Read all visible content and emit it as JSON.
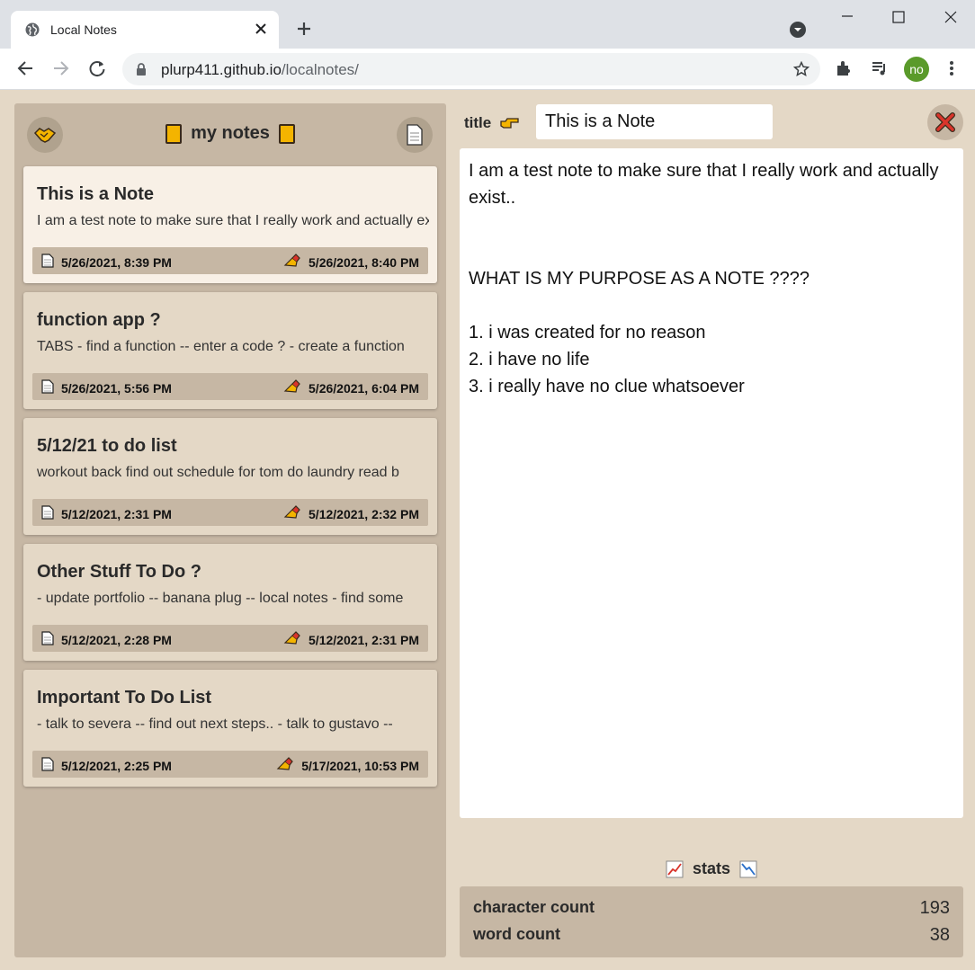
{
  "browser": {
    "tab_title": "Local Notes",
    "url_host": "plurp411.github.io",
    "url_path": "/localnotes/",
    "profile_initials": "no"
  },
  "sidebar": {
    "heading": "my notes",
    "notes": [
      {
        "title": "This is a Note",
        "preview": "I am a test note to make sure that I really work and actually exist..",
        "created": "5/26/2021, 8:39 PM",
        "edited": "5/26/2021, 8:40 PM"
      },
      {
        "title": "function app ?",
        "preview": "TABS - find a function -- enter a code ? - create a function",
        "created": "5/26/2021, 5:56 PM",
        "edited": "5/26/2021, 6:04 PM"
      },
      {
        "title": "5/12/21 to do list",
        "preview": "workout back find out schedule for tom do laundry read b",
        "created": "5/12/2021, 2:31 PM",
        "edited": "5/12/2021, 2:32 PM"
      },
      {
        "title": "Other Stuff To Do ?",
        "preview": "- update portfolio -- banana plug -- local notes - find some",
        "created": "5/12/2021, 2:28 PM",
        "edited": "5/12/2021, 2:31 PM"
      },
      {
        "title": "Important To Do List",
        "preview": "- talk to severa -- find out next steps.. - talk to gustavo --",
        "created": "5/12/2021, 2:25 PM",
        "edited": "5/17/2021, 10:53 PM"
      }
    ]
  },
  "editor": {
    "title_label": "title",
    "title_value": "This is a Note",
    "body": "I am a test note to make sure that I really work and actually exist..\n\n\nWHAT IS MY PURPOSE AS A NOTE ????\n\n1. i was created for no reason\n2. i have no life\n3. i really have no clue whatsoever"
  },
  "stats": {
    "heading": "stats",
    "character_count_label": "character count",
    "character_count": "193",
    "word_count_label": "word count",
    "word_count": "38"
  },
  "colors": {
    "page_bg": "#e4d8c6",
    "panel_bg": "#c6b7a4",
    "active_card": "#f8f0e6",
    "accent_yellow": "#f4b400",
    "close_red": "#d9342b"
  }
}
